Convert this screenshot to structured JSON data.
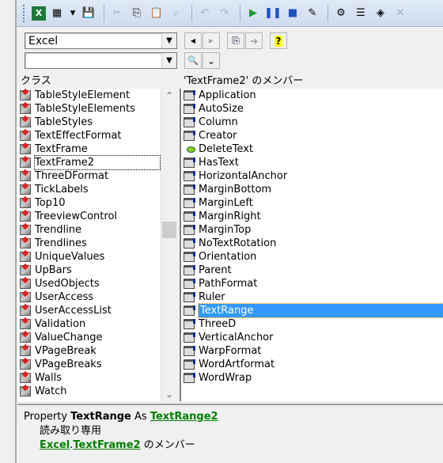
{
  "toolbar": {
    "buttons": [
      {
        "name": "excel-icon",
        "glyph": "X"
      },
      {
        "name": "insert-userform-icon",
        "glyph": "▦"
      },
      {
        "name": "dropdown-arrow-icon",
        "glyph": "▾"
      },
      {
        "name": "save-icon",
        "glyph": "💾"
      },
      {
        "name": "cut-icon",
        "glyph": "✂"
      },
      {
        "name": "copy-icon",
        "glyph": "⎘"
      },
      {
        "name": "paste-icon",
        "glyph": "📋"
      },
      {
        "name": "find-icon",
        "glyph": "⌕"
      },
      {
        "name": "undo-icon",
        "glyph": "↶"
      },
      {
        "name": "redo-icon",
        "glyph": "↷"
      },
      {
        "name": "run-icon",
        "glyph": "▶"
      },
      {
        "name": "pause-icon",
        "glyph": "❚❚"
      },
      {
        "name": "stop-icon",
        "glyph": "■"
      },
      {
        "name": "design-mode-icon",
        "glyph": "✎"
      },
      {
        "name": "project-explorer-icon",
        "glyph": "⚙"
      },
      {
        "name": "properties-icon",
        "glyph": "☰"
      },
      {
        "name": "object-browser-icon",
        "glyph": "◈"
      },
      {
        "name": "toolbox-icon",
        "glyph": "✕"
      }
    ]
  },
  "library_combo": {
    "value": "Excel"
  },
  "search_combo": {
    "value": ""
  },
  "nav": {
    "back": "◀",
    "forward": "▶",
    "copy": "⎘",
    "view_def": "➔",
    "help": "?",
    "search": "🔍",
    "toggle": "⌄"
  },
  "classes": {
    "header": "クラス",
    "items": [
      "TableStyleElement",
      "TableStyleElements",
      "TableStyles",
      "TextEffectFormat",
      "TextFrame",
      "TextFrame2",
      "ThreeDFormat",
      "TickLabels",
      "Top10",
      "TreeviewControl",
      "Trendline",
      "Trendlines",
      "UniqueValues",
      "UpBars",
      "UsedObjects",
      "UserAccess",
      "UserAccessList",
      "Validation",
      "ValueChange",
      "VPageBreak",
      "VPageBreaks",
      "Walls",
      "Watch"
    ],
    "focused": "TextFrame2"
  },
  "members": {
    "header": "'TextFrame2' のメンバー",
    "items": [
      {
        "label": "Application",
        "kind": "property"
      },
      {
        "label": "AutoSize",
        "kind": "property"
      },
      {
        "label": "Column",
        "kind": "property"
      },
      {
        "label": "Creator",
        "kind": "property"
      },
      {
        "label": "DeleteText",
        "kind": "method"
      },
      {
        "label": "HasText",
        "kind": "property"
      },
      {
        "label": "HorizontalAnchor",
        "kind": "property"
      },
      {
        "label": "MarginBottom",
        "kind": "property"
      },
      {
        "label": "MarginLeft",
        "kind": "property"
      },
      {
        "label": "MarginRight",
        "kind": "property"
      },
      {
        "label": "MarginTop",
        "kind": "property"
      },
      {
        "label": "NoTextRotation",
        "kind": "property"
      },
      {
        "label": "Orientation",
        "kind": "property"
      },
      {
        "label": "Parent",
        "kind": "property"
      },
      {
        "label": "PathFormat",
        "kind": "property"
      },
      {
        "label": "Ruler",
        "kind": "property"
      },
      {
        "label": "TextRange",
        "kind": "property"
      },
      {
        "label": "ThreeD",
        "kind": "property"
      },
      {
        "label": "VerticalAnchor",
        "kind": "property"
      },
      {
        "label": "WarpFormat",
        "kind": "property"
      },
      {
        "label": "WordArtformat",
        "kind": "property"
      },
      {
        "label": "WordWrap",
        "kind": "property"
      }
    ],
    "selected": "TextRange"
  },
  "detail": {
    "prefix": "Property",
    "name": "TextRange",
    "as": "As",
    "type": "TextRange2",
    "readonly": "読み取り専用",
    "library": "Excel",
    "dot": ".",
    "class": "TextFrame2",
    "member_of": "のメンバー"
  },
  "colors": {
    "selection": "#3399ff",
    "link": "#008000"
  }
}
